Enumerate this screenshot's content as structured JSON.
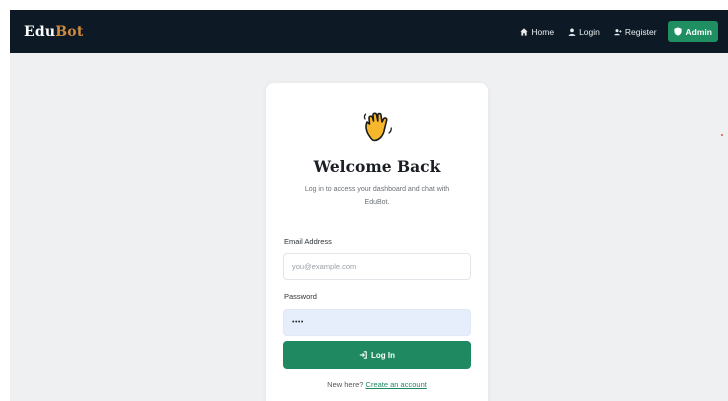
{
  "brand": {
    "part1": "Edu",
    "part2": "Bot",
    "accent_color": "#d08a3c"
  },
  "nav": {
    "home": {
      "label": "Home",
      "icon": "home-icon"
    },
    "login": {
      "label": "Login",
      "icon": "user-icon"
    },
    "register": {
      "label": "Register",
      "icon": "user-plus-icon"
    },
    "admin": {
      "label": "Admin",
      "icon": "shield-icon",
      "color": "#1f8f62"
    }
  },
  "card": {
    "emoji": "waving-hand-icon",
    "title": "Welcome Back",
    "subtitle": "Log in to access your dashboard and chat with EduBot.",
    "email": {
      "label": "Email Address",
      "placeholder": "you@example.com",
      "value": ""
    },
    "password": {
      "label": "Password",
      "value": "••••"
    },
    "submit": {
      "label": "Log In",
      "icon": "login-icon",
      "color": "#1f8a62"
    },
    "signup": {
      "prompt": "New here?",
      "link": "Create an account"
    }
  },
  "colors": {
    "navbar": "#0d1a26",
    "page_bg": "#eff0f2"
  }
}
